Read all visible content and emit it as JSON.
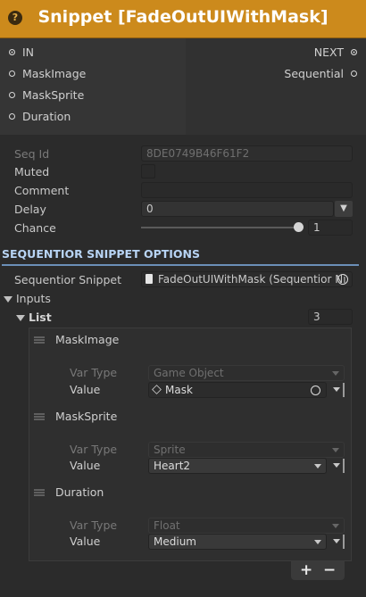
{
  "header": {
    "title": "Snippet [FadeOutUIWithMask]",
    "help_glyph": "?"
  },
  "ports": {
    "inputs": [
      "IN",
      "MaskImage",
      "MaskSprite",
      "Duration"
    ],
    "outputs": [
      "NEXT",
      "Sequential"
    ]
  },
  "props": {
    "seq_id": {
      "label": "Seq Id",
      "value": "8DE0749B46F61F2"
    },
    "muted": {
      "label": "Muted",
      "checked": false
    },
    "comment": {
      "label": "Comment",
      "value": ""
    },
    "delay": {
      "label": "Delay",
      "value": "0"
    },
    "chance": {
      "label": "Chance",
      "value": "1",
      "slider_fraction": 1.0
    }
  },
  "section": {
    "title": "SEQUENTIOR SNIPPET OPTIONS",
    "snippet_label": "Sequentior Snippet",
    "snippet_value": "FadeOutUIWithMask (Sequentior Ni",
    "inputs_label": "Inputs",
    "list_label": "List",
    "list_count": "3"
  },
  "list": {
    "var_type_label": "Var Type",
    "value_label": "Value",
    "items": [
      {
        "name": "MaskImage",
        "var_type": "Game Object",
        "value": "Mask"
      },
      {
        "name": "MaskSprite",
        "var_type": "Sprite",
        "value": "Heart2"
      },
      {
        "name": "Duration",
        "var_type": "Float",
        "value": "Medium"
      }
    ]
  },
  "buttons": {
    "add": "+",
    "remove": "−"
  }
}
